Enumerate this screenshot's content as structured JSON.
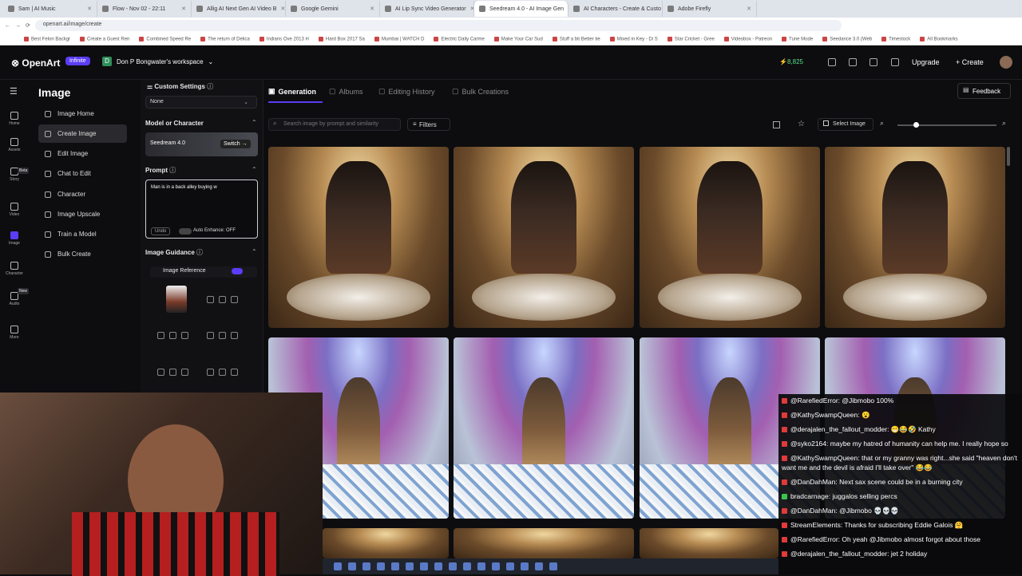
{
  "browser": {
    "tabs": [
      "Sam | AI Music",
      "Flow - Nov 02 - 22:11",
      "Allig AI Next Gen AI Video B",
      "Google Gemini",
      "AI Lip Sync Video Generator",
      "Seedream 4.0 - AI Image Gen",
      "AI Characters - Create & Custo",
      "Adobe Firefly"
    ],
    "url": "openart.ai/image/create",
    "bookmarks": [
      "Best Felon Backgr",
      "Create a Guest Ren",
      "Combined Speed Re",
      "The return of Delica",
      "Indians Ove 2013 H",
      "Hard Box 2017 Sa",
      "Mumbai | WATCH D",
      "Electric Daily Carme",
      "Make Your Car Sud",
      "Stuff a bit Better tie",
      "Mixed in Key - Di S",
      "Star Cricket - Gree",
      "Videobox - Patreon",
      "Tune Mode",
      "Seedance 3.0 (Web",
      "Timestock",
      "All Bookmarks"
    ]
  },
  "header": {
    "logo": "OpenArt",
    "plan_badge": "Infinite",
    "workspace_initial": "D",
    "workspace": "Don P Bongwater's workspace",
    "credits": "8,825",
    "upgrade": "Upgrade",
    "create": "Create"
  },
  "rail": [
    {
      "label": "Home",
      "icon": "home-icon"
    },
    {
      "label": "Assets",
      "icon": "folder-icon"
    },
    {
      "label": "Story",
      "icon": "story-icon",
      "badge": "Beta"
    },
    {
      "label": "Video",
      "icon": "video-icon"
    },
    {
      "label": "Image",
      "icon": "image-icon"
    },
    {
      "label": "Character",
      "icon": "character-icon"
    },
    {
      "label": "Audio",
      "icon": "audio-icon",
      "badge": "New"
    },
    {
      "label": "More",
      "icon": "more-icon"
    }
  ],
  "nav": {
    "title": "Image",
    "items": [
      "Image Home",
      "Create Image",
      "Edit Image",
      "Chat to Edit",
      "Character",
      "Image Upscale",
      "Train a Model",
      "Bulk Create"
    ]
  },
  "settings": {
    "custom_label": "Custom Settings",
    "custom_value": "None",
    "model_label": "Model or Character",
    "model_name": "Seedream 4.0",
    "switch": "Switch",
    "prompt_label": "Prompt",
    "prompt_text": "Man is in a back alley buying w",
    "undo": "Undo",
    "auto_enhance": "Auto Enhance: OFF",
    "guidance_label": "Image Guidance",
    "image_reference": "Image Reference"
  },
  "main": {
    "tabs": [
      "Generation",
      "Albums",
      "Editing History",
      "Bulk Creations"
    ],
    "feedback": "Feedback",
    "search_placeholder": "Search image by prompt and similarity",
    "filters": "Filters",
    "select_image": "Select Image"
  },
  "chat": [
    {
      "user": "@RarefiedError:",
      "text": "@Jibmobo 100%"
    },
    {
      "user": "@KathySwampQueen:",
      "text": "😮"
    },
    {
      "user": "@derajalen_the_fallout_modder:",
      "text": "😁😂🤣 Kathy"
    },
    {
      "user": "@syko2164:",
      "text": "maybe my hatred of humanity can help me. I really hope so"
    },
    {
      "user": "@KathySwampQueen:",
      "text": "that or my granny was right...she said \"heaven don't want me and the devil is afraid I'll take over\" 😂😂"
    },
    {
      "user": "@DanDahMan:",
      "text": "Next sax scene could be in a burning city"
    },
    {
      "user": "bradcarnage:",
      "text": "juggalos selling percs"
    },
    {
      "user": "@DanDahMan:",
      "text": "@Jibmobo 💀💀💀"
    },
    {
      "user": "StreamElements:",
      "text": "Thanks for subscribing Eddie Galois 🤗"
    },
    {
      "user": "@RarefiedError:",
      "text": "Oh yeah @Jibmobo almost forgot about those"
    },
    {
      "user": "@derajalen_the_fallout_modder:",
      "text": "jet 2 holiday"
    }
  ]
}
